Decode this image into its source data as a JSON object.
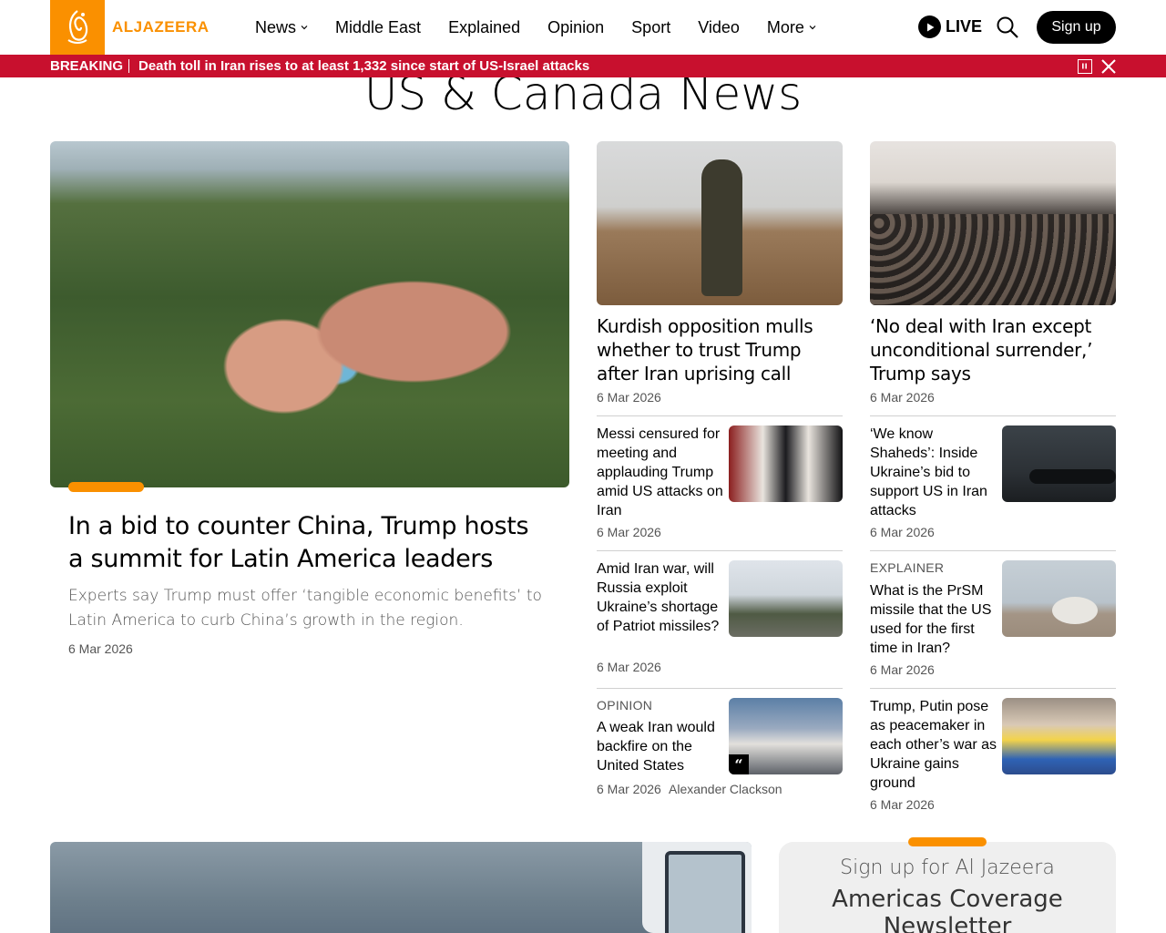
{
  "brand": {
    "name": "ALJAZEERA",
    "accent_color": "#fa9000"
  },
  "nav": {
    "items": [
      {
        "label": "News",
        "has_dropdown": true
      },
      {
        "label": "Middle East",
        "has_dropdown": false
      },
      {
        "label": "Explained",
        "has_dropdown": false
      },
      {
        "label": "Opinion",
        "has_dropdown": false
      },
      {
        "label": "Sport",
        "has_dropdown": false
      },
      {
        "label": "Video",
        "has_dropdown": false
      },
      {
        "label": "More",
        "has_dropdown": true
      }
    ],
    "live_label": "LIVE",
    "signup_label": "Sign up"
  },
  "breaking": {
    "tag": "BREAKING",
    "text": "Death toll in Iran rises to at least 1,332 since start of US-Israel attacks",
    "bar_color": "#c8102e"
  },
  "page": {
    "title": "US & Canada News"
  },
  "main_story": {
    "headline": "In a bid to counter China, Trump hosts a summit for Latin America leaders",
    "summary": "Experts say Trump must offer ‘tangible economic benefits’ to Latin America to curb China’s growth in the region.",
    "date": "6 Mar 2026"
  },
  "featured": [
    {
      "headline": "Kurdish opposition mulls whether to trust Trump after Iran uprising call",
      "date": "6 Mar 2026"
    },
    {
      "headline": "‘No deal with Iran except unconditional surrender,’ Trump says",
      "date": "6 Mar 2026"
    }
  ],
  "stories": [
    {
      "kicker": "",
      "headline": "Messi censured for meeting and applauding Trump amid US attacks on Iran",
      "date": "6 Mar 2026",
      "author": ""
    },
    {
      "kicker": "",
      "headline": "‘We know Shaheds’: Inside Ukraine’s bid to support US in Iran attacks",
      "date": "6 Mar 2026",
      "author": ""
    },
    {
      "kicker": "",
      "headline": "Amid Iran war, will Russia exploit Ukraine’s shortage of Patriot missiles?",
      "date": "6 Mar 2026",
      "author": ""
    },
    {
      "kicker": "EXPLAINER",
      "headline": "What is the PrSM missile that the US used for the first time in Iran?",
      "date": "6 Mar 2026",
      "author": ""
    },
    {
      "kicker": "OPINION",
      "headline": "A weak Iran would backfire on the United States",
      "date": "6 Mar 2026",
      "author": "Alexander Clackson"
    },
    {
      "kicker": "",
      "headline": "Trump, Putin pose as peacemaker in each other’s war as Ukraine gains ground",
      "date": "6 Mar 2026",
      "author": ""
    }
  ],
  "newsletter": {
    "subtitle": "Sign up for Al Jazeera",
    "title": "Americas Coverage Newsletter"
  }
}
